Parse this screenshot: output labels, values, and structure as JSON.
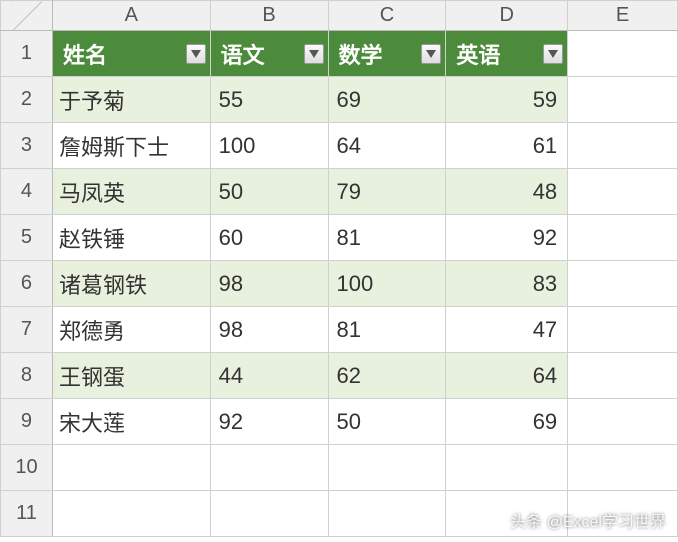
{
  "columns": {
    "A": "A",
    "B": "B",
    "C": "C",
    "D": "D",
    "E": "E"
  },
  "row_labels": [
    "1",
    "2",
    "3",
    "4",
    "5",
    "6",
    "7",
    "8",
    "9",
    "10",
    "11"
  ],
  "headers": {
    "name": "姓名",
    "chinese": "语文",
    "math": "数学",
    "english": "英语"
  },
  "rows": [
    {
      "name": "于予菊",
      "chinese": "55",
      "math": "69",
      "english": "59"
    },
    {
      "name": "詹姆斯下士",
      "chinese": "100",
      "math": "64",
      "english": "61"
    },
    {
      "name": "马凤英",
      "chinese": "50",
      "math": "79",
      "english": "48"
    },
    {
      "name": "赵铁锤",
      "chinese": "60",
      "math": "81",
      "english": "92"
    },
    {
      "name": "诸葛钢铁",
      "chinese": "98",
      "math": "100",
      "english": "83"
    },
    {
      "name": "郑德勇",
      "chinese": "98",
      "math": "81",
      "english": "47"
    },
    {
      "name": "王钢蛋",
      "chinese": "44",
      "math": "62",
      "english": "64"
    },
    {
      "name": "宋大莲",
      "chinese": "92",
      "math": "50",
      "english": "69"
    }
  ],
  "watermark": "头条 @Excel学习世界",
  "chart_data": {
    "type": "table",
    "title": "",
    "columns": [
      "姓名",
      "语文",
      "数学",
      "英语"
    ],
    "data": [
      [
        "于予菊",
        55,
        69,
        59
      ],
      [
        "詹姆斯下士",
        100,
        64,
        61
      ],
      [
        "马凤英",
        50,
        79,
        48
      ],
      [
        "赵铁锤",
        60,
        81,
        92
      ],
      [
        "诸葛钢铁",
        98,
        100,
        83
      ],
      [
        "郑德勇",
        98,
        81,
        47
      ],
      [
        "王钢蛋",
        44,
        62,
        64
      ],
      [
        "宋大莲",
        92,
        50,
        69
      ]
    ]
  }
}
